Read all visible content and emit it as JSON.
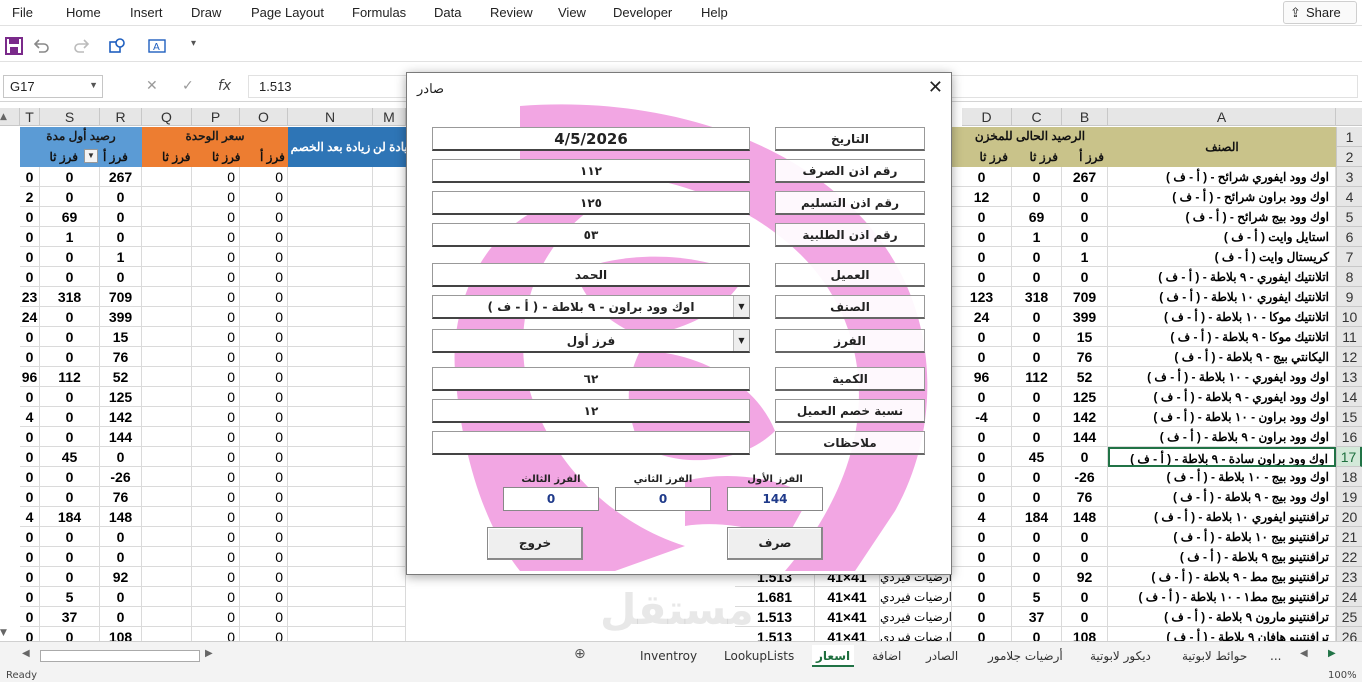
{
  "menu": [
    "File",
    "Home",
    "Insert",
    "Draw",
    "Page Layout",
    "Formulas",
    "Data",
    "Review",
    "View",
    "Developer",
    "Help"
  ],
  "share": "Share",
  "namebox": "G17",
  "formula": "1.513",
  "formula_icons": {
    "cancel": "✕",
    "enter": "✓",
    "fx": "fx"
  },
  "cols_left": [
    "T",
    "S",
    "R",
    "Q",
    "P",
    "O",
    "N",
    "M"
  ],
  "cols_right": [
    "D",
    "C",
    "B",
    "A"
  ],
  "header_left": {
    "group1": "رصيد أول مدة",
    "group2": "سعر الوحدة",
    "group3": "زيادة بعد الخصم",
    "group4": "زيادة لن"
  },
  "header_right": {
    "group1": "الرصيد الحالى للمخزن",
    "item": "الصنف"
  },
  "sub_headers": {
    "f1": "فرز أ",
    "f2": "فرز ثا",
    "f3": "فرز ثا"
  },
  "rows": [
    {
      "n": "1",
      "sel": false
    },
    {
      "n": "2",
      "sel": false
    },
    {
      "n": "3",
      "sel": false
    },
    {
      "n": "4",
      "sel": false
    },
    {
      "n": "5",
      "sel": false
    },
    {
      "n": "6",
      "sel": false
    },
    {
      "n": "7",
      "sel": false
    },
    {
      "n": "8",
      "sel": false
    },
    {
      "n": "9",
      "sel": false
    },
    {
      "n": "10",
      "sel": false
    },
    {
      "n": "11",
      "sel": false
    },
    {
      "n": "12",
      "sel": false
    },
    {
      "n": "13",
      "sel": false
    },
    {
      "n": "14",
      "sel": false
    },
    {
      "n": "15",
      "sel": false
    },
    {
      "n": "16",
      "sel": false
    },
    {
      "n": "17",
      "sel": true
    },
    {
      "n": "18",
      "sel": false
    },
    {
      "n": "19",
      "sel": false
    },
    {
      "n": "20",
      "sel": false
    },
    {
      "n": "21",
      "sel": false
    },
    {
      "n": "22",
      "sel": false
    },
    {
      "n": "23",
      "sel": false
    },
    {
      "n": "24",
      "sel": false
    },
    {
      "n": "25",
      "sel": false
    },
    {
      "n": "26",
      "sel": false
    }
  ],
  "left_data": [
    [
      "0",
      "0",
      "267",
      "0",
      "0"
    ],
    [
      "2",
      "0",
      "0",
      "0",
      "0"
    ],
    [
      "0",
      "69",
      "0",
      "0",
      "0"
    ],
    [
      "0",
      "1",
      "0",
      "0",
      "0"
    ],
    [
      "0",
      "0",
      "1",
      "0",
      "0"
    ],
    [
      "0",
      "0",
      "0",
      "0",
      "0"
    ],
    [
      "23",
      "318",
      "709",
      "0",
      "0"
    ],
    [
      "24",
      "0",
      "399",
      "0",
      "0"
    ],
    [
      "0",
      "0",
      "15",
      "0",
      "0"
    ],
    [
      "0",
      "0",
      "76",
      "0",
      "0"
    ],
    [
      "96",
      "112",
      "52",
      "0",
      "0"
    ],
    [
      "0",
      "0",
      "125",
      "0",
      "0"
    ],
    [
      "4",
      "0",
      "142",
      "0",
      "0"
    ],
    [
      "0",
      "0",
      "144",
      "0",
      "0"
    ],
    [
      "0",
      "45",
      "0",
      "0",
      "0"
    ],
    [
      "0",
      "0",
      "-26",
      "0",
      "0"
    ],
    [
      "0",
      "0",
      "76",
      "0",
      "0"
    ],
    [
      "4",
      "184",
      "148",
      "0",
      "0"
    ],
    [
      "0",
      "0",
      "0",
      "0",
      "0"
    ],
    [
      "0",
      "0",
      "0",
      "0",
      "0"
    ],
    [
      "0",
      "0",
      "92",
      "0",
      "0"
    ],
    [
      "0",
      "5",
      "0",
      "0",
      "0"
    ],
    [
      "0",
      "37",
      "0",
      "0",
      "0"
    ],
    [
      "0",
      "0",
      "108",
      "0",
      "0"
    ]
  ],
  "right_data": [
    [
      "0",
      "0",
      "267",
      "اوك وود ايفوري شرائح -  ( أ - ف )"
    ],
    [
      "12",
      "0",
      "0",
      "اوك وود براون شرائح -  ( أ - ف )"
    ],
    [
      "0",
      "69",
      "0",
      "اوك وود بيج شرائح -  ( أ - ف )"
    ],
    [
      "0",
      "1",
      "0",
      "استايل وايت ( أ - ف )"
    ],
    [
      "0",
      "0",
      "1",
      "كريستال وايت ( أ - ف )"
    ],
    [
      "0",
      "0",
      "0",
      "اتلانتيك ايفوري - ٩ بلاطة  -  ( أ - ف )"
    ],
    [
      "123",
      "318",
      "709",
      "اتلانتيك ايفوري ١٠ بلاطة -  ( أ - ف )"
    ],
    [
      "24",
      "0",
      "399",
      "اتلانتيك موكا - ١٠ بلاطة -  ( أ - ف )"
    ],
    [
      "0",
      "0",
      "15",
      "اتلانتيك موكا - ٩ بلاطة -  ( أ - ف )"
    ],
    [
      "0",
      "0",
      "76",
      "اليكانتي بيج  - ٩ بلاطة  -  ( أ - ف )"
    ],
    [
      "96",
      "112",
      "52",
      "اوك وود ايفوري - ١٠ بلاطة -  ( أ - ف )"
    ],
    [
      "0",
      "0",
      "125",
      "اوك وود ايفوري - ٩ بلاطة -  ( أ - ف )"
    ],
    [
      "-4",
      "0",
      "142",
      "اوك وود براون - ١٠ بلاطة -  ( أ - ف )"
    ],
    [
      "0",
      "0",
      "144",
      "اوك وود براون - ٩ بلاطة -  ( أ - ف )"
    ],
    [
      "0",
      "45",
      "0",
      "اوك وود براون سادة - ٩ بلاطة -  ( أ - ف )"
    ],
    [
      "0",
      "0",
      "-26",
      "اوك وود بيج - ١٠ بلاطة -  ( أ - ف )"
    ],
    [
      "0",
      "0",
      "76",
      "اوك وود بيج - ٩ بلاطة -  ( أ - ف )"
    ],
    [
      "4",
      "184",
      "148",
      "ترافنتينو ايفوري ١٠ بلاطة -  ( أ - ف )"
    ],
    [
      "0",
      "0",
      "0",
      "ترافنتينو بيج ١٠ بلاطة -  ( أ - ف )"
    ],
    [
      "0",
      "0",
      "0",
      "ترافنتينو بيج ٩ بلاطة -  ( أ - ف )"
    ],
    [
      "0",
      "0",
      "92",
      "ترافنتينو بيج مط - ٩ بلاطة -  ( أ - ف )"
    ],
    [
      "0",
      "5",
      "0",
      "ترافنتينو بيج مط١ - ١٠ بلاطة -  ( أ - ف )"
    ],
    [
      "0",
      "37",
      "0",
      "ترافنتينو مارون ٩ بلاطة -  ( أ - ف )"
    ],
    [
      "0",
      "0",
      "108",
      "ترافنتينو هافان ٩ بلاطة -  ( أ - ف )"
    ]
  ],
  "mid_rows": [
    {
      "g": "1.513",
      "f": "41×41",
      "e": "ارضيات فيردي"
    },
    {
      "g": "1.681",
      "f": "41×41",
      "e": "ارضيات فيردي"
    },
    {
      "g": "1.513",
      "f": "41×41",
      "e": "ارضيات فيردي"
    },
    {
      "g": "1.513",
      "f": "41×41",
      "e": "ارضيات فيردي"
    }
  ],
  "dialog": {
    "title": "صادر",
    "labels": [
      "التاريخ",
      "رقم اذن الصرف",
      "رقم اذن التسليم",
      "رقم اذن الطلبية",
      "العميل",
      "الصنف",
      "الفرز",
      "الكمية",
      "نسبة خصم العميل",
      "ملاحظات"
    ],
    "values": [
      "4/5/2026",
      "١١٢",
      "١٢٥",
      "٥٣",
      "الحمد",
      "اوك وود براون - ٩ بلاطة -  ( أ - ف )",
      "فرز أول",
      "٦٢",
      "١٢",
      ""
    ],
    "sort_labels": {
      "third": "الفرز الثالث",
      "second": "الفرز الثاني",
      "first": "الفرز الأول"
    },
    "sort_values": {
      "third": "0",
      "second": "0",
      "first": "144"
    },
    "exit_button": "خروج",
    "issue_button": "صرف"
  },
  "tabs": [
    "Inventroy",
    "LookupLists",
    "اسعار",
    "اضافة",
    "الصادر",
    "أرضيات جلامور",
    "ديكور لابوتية",
    "حوائط لابوتية",
    "..."
  ],
  "status": {
    "ready": "Ready",
    "zoom": "100%"
  },
  "watermark": "مستقل",
  "accent": "#217346"
}
